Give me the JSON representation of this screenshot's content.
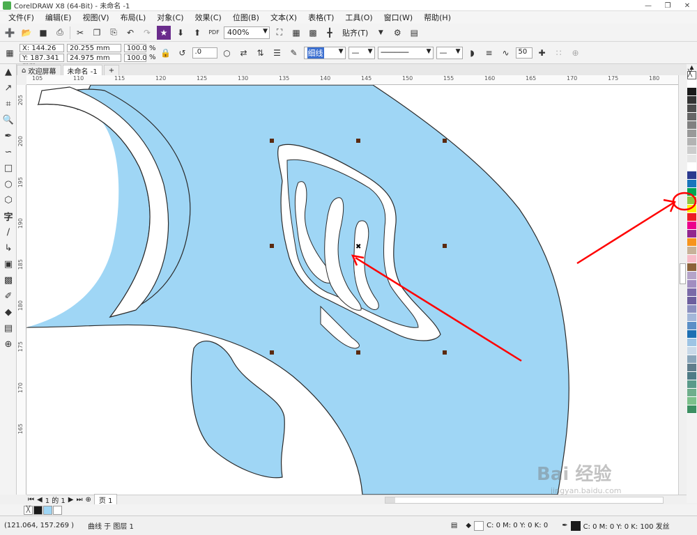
{
  "app": {
    "title": "CorelDRAW X8 (64-Bit) - 未命名 -1",
    "win_min": "—",
    "win_restore": "❐",
    "win_close": "✕"
  },
  "menu": [
    "文件(F)",
    "编辑(E)",
    "视图(V)",
    "布局(L)",
    "对象(C)",
    "效果(C)",
    "位图(B)",
    "文本(X)",
    "表格(T)",
    "工具(O)",
    "窗口(W)",
    "帮助(H)"
  ],
  "toolbar1": {
    "zoom": "400%",
    "snap": "贴齐(T)"
  },
  "toolbar2": {
    "x": "X: 144.26 mm",
    "y": "Y: 187.341 mm",
    "w": "20.255 mm",
    "h": "24.975 mm",
    "sx": "100.0",
    "sy": "100.0",
    "pct": "%",
    "angle": ".0",
    "outline": "细线",
    "smooth": "50"
  },
  "tabs": [
    "欢迎屏幕",
    "未命名 -1"
  ],
  "ruler_h": [
    "105",
    "110",
    "115",
    "120",
    "125",
    "130",
    "135",
    "140",
    "145",
    "150",
    "155",
    "160",
    "165",
    "170",
    "175",
    "180"
  ],
  "ruler_v": [
    "205",
    "200",
    "195",
    "190",
    "185",
    "180",
    "175",
    "170",
    "165"
  ],
  "page_nav": {
    "pages": "1  的 1",
    "page_tab": "页 1"
  },
  "status": {
    "coords": "(121.064, 157.269 )",
    "info": "曲线 于 图层 1",
    "fill_info": "C: 0 M: 0 Y: 0 K: 0",
    "outline_info": "C: 0 M: 0 Y: 0 K: 100  发丝"
  },
  "palette_colors": [
    "#ffffff",
    "#1a1a1a",
    "#333333",
    "#4d4d4d",
    "#666666",
    "#808080",
    "#999999",
    "#b3b3b3",
    "#cccccc",
    "#e6e6e6",
    "#ffffff",
    "#2b3a8f",
    "#1a75bc",
    "#00a651",
    "#8dc63f",
    "#fff200",
    "#ed1c24",
    "#ec008c",
    "#92278f",
    "#f7941d",
    "#c7b299",
    "#f7bcc8",
    "#8c6239",
    "#b5a4c9",
    "#a18dc0",
    "#7b6aa8",
    "#6d5f9e",
    "#8b8fbf",
    "#a3b7d9",
    "#5b8fc7",
    "#1e6fb3",
    "#9ec4e4",
    "#c9d9e8",
    "#8aa6ba",
    "#607d8b",
    "#4f7b86",
    "#5a9a8a",
    "#6fae8c",
    "#7cc08b",
    "#3c8f62"
  ],
  "watermark": {
    "brand": "Bai 经验",
    "url": "jingyan.baidu.com"
  },
  "colors": {
    "shape_fill": "#9fd6f5",
    "outline": "#2a2a2a",
    "annotation": "#ff0000"
  }
}
